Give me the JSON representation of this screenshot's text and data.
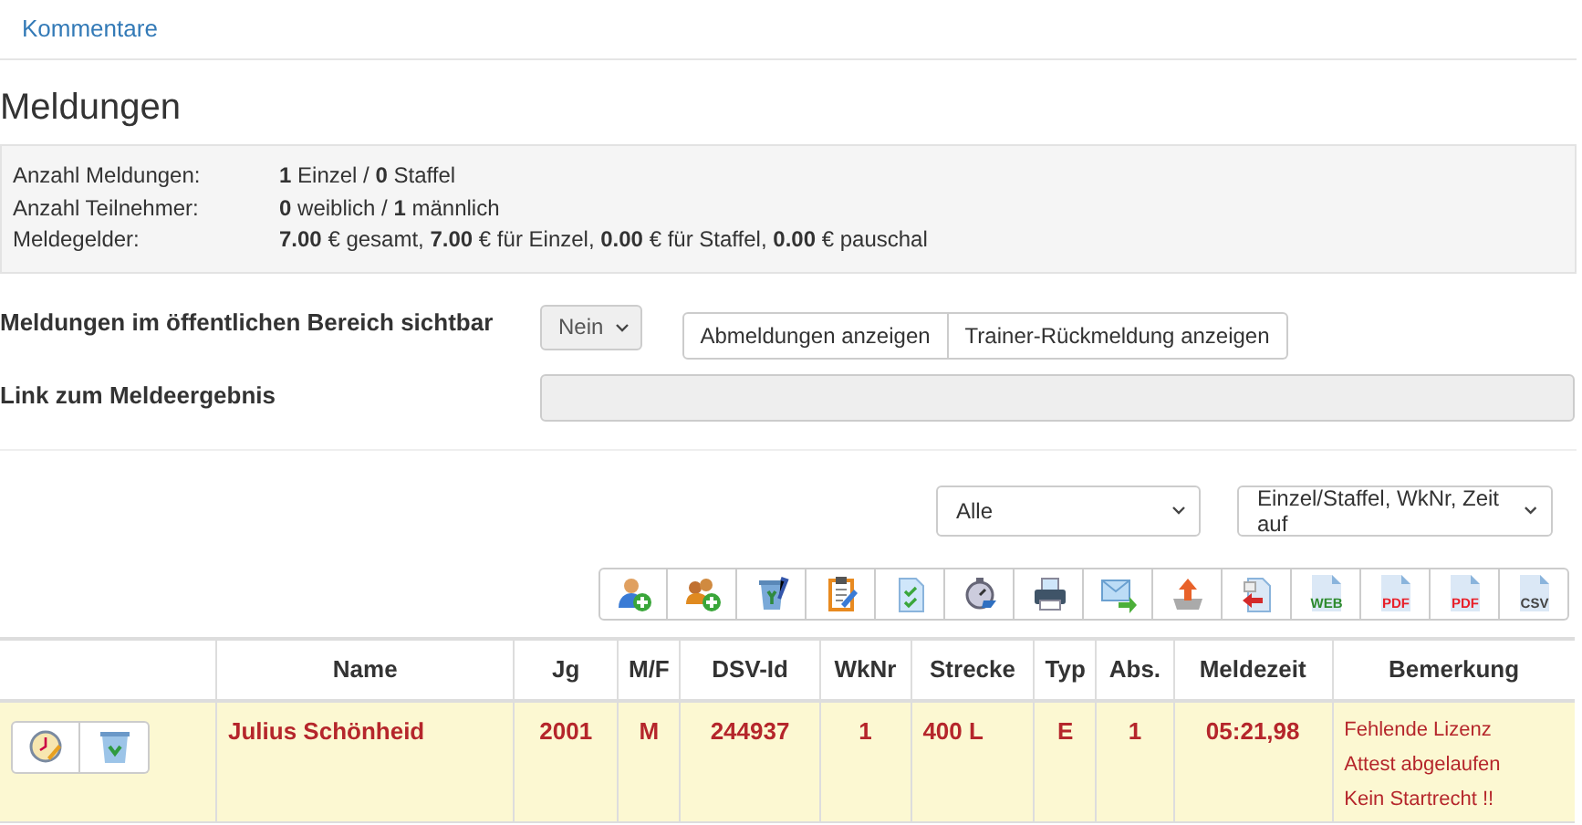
{
  "top_link": "Kommentare",
  "heading": "Meldungen",
  "summary": [
    {
      "label": "Anzahl Meldungen:",
      "value": "**1** Einzel / **0** Staffel"
    },
    {
      "label": "Anzahl Teilnehmer:",
      "value": "**0** weiblich / **1** männlich"
    },
    {
      "label": "Meldegelder:",
      "value": "**7.00** € gesamt, **7.00** € für Einzel, **0.00** € für Staffel, **0.00** € pauschal"
    }
  ],
  "visibility": {
    "label": "Meldungen im öffentlichen Bereich sichtbar",
    "value": "Nein"
  },
  "view_buttons": [
    "Abmeldungen anzeigen",
    "Trainer-Rückmeldung anzeigen"
  ],
  "result_link": {
    "label": "Link zum Meldeergebnis",
    "disabled": true
  },
  "filter": {
    "value": "Alle"
  },
  "sort": {
    "value": "Einzel/Staffel, WkNr, Zeit auf"
  },
  "toolbar": [
    {
      "kind": "addperson"
    },
    {
      "kind": "addgroup"
    },
    {
      "kind": "recycle"
    },
    {
      "kind": "clipboard"
    },
    {
      "kind": "checklist"
    },
    {
      "kind": "stopwatch"
    },
    {
      "kind": "printer"
    },
    {
      "kind": "mail"
    },
    {
      "kind": "upload"
    },
    {
      "kind": "import"
    },
    {
      "kind": "file",
      "label": "WEB",
      "color": "#2e8b2e"
    },
    {
      "kind": "file",
      "label": "PDF",
      "color": "#e8202a"
    },
    {
      "kind": "file",
      "label": "PDF",
      "color": "#e8202a"
    },
    {
      "kind": "file",
      "label": "CSV",
      "color": "#444444"
    }
  ],
  "table": {
    "columns": [
      "Name",
      "Jg",
      "M/F",
      "DSV-Id",
      "WkNr",
      "Strecke",
      "Typ",
      "Abs.",
      "Meldezeit",
      "Bemerkung"
    ],
    "rows": [
      {
        "highlighted": true,
        "cells": [
          "Julius Schönheid",
          "2001",
          "M",
          "244937",
          "1",
          "400 L",
          "E",
          "1",
          "05:21,98"
        ],
        "remarks": [
          "Fehlende Lizenz",
          "Attest abgelaufen",
          "Kein Startrecht !!"
        ]
      }
    ]
  }
}
